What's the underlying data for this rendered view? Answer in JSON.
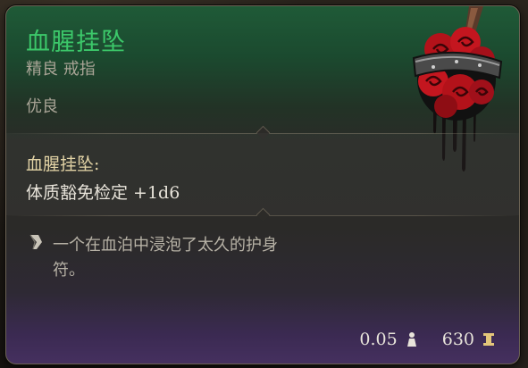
{
  "item": {
    "name": "血腥挂坠",
    "type_line": "精良 戒指",
    "rarity": "优良",
    "art_icon": "bloody-pendant-icon"
  },
  "effects": {
    "title": "血腥挂坠:",
    "description": "体质豁免检定 +1d6"
  },
  "flavor": {
    "icon": "quill-icon",
    "line1": "一个在血泊中浸泡了太久的护身",
    "line2": "符。"
  },
  "footer": {
    "weight": "0.05",
    "weight_icon": "weight-icon",
    "value": "630",
    "value_icon": "gold-coin-icon"
  },
  "colors": {
    "name_green": "#3cc86a",
    "effect_title_gold": "#e3d4a6",
    "header_green": "#1f5a37",
    "footer_purple": "#45305f"
  }
}
